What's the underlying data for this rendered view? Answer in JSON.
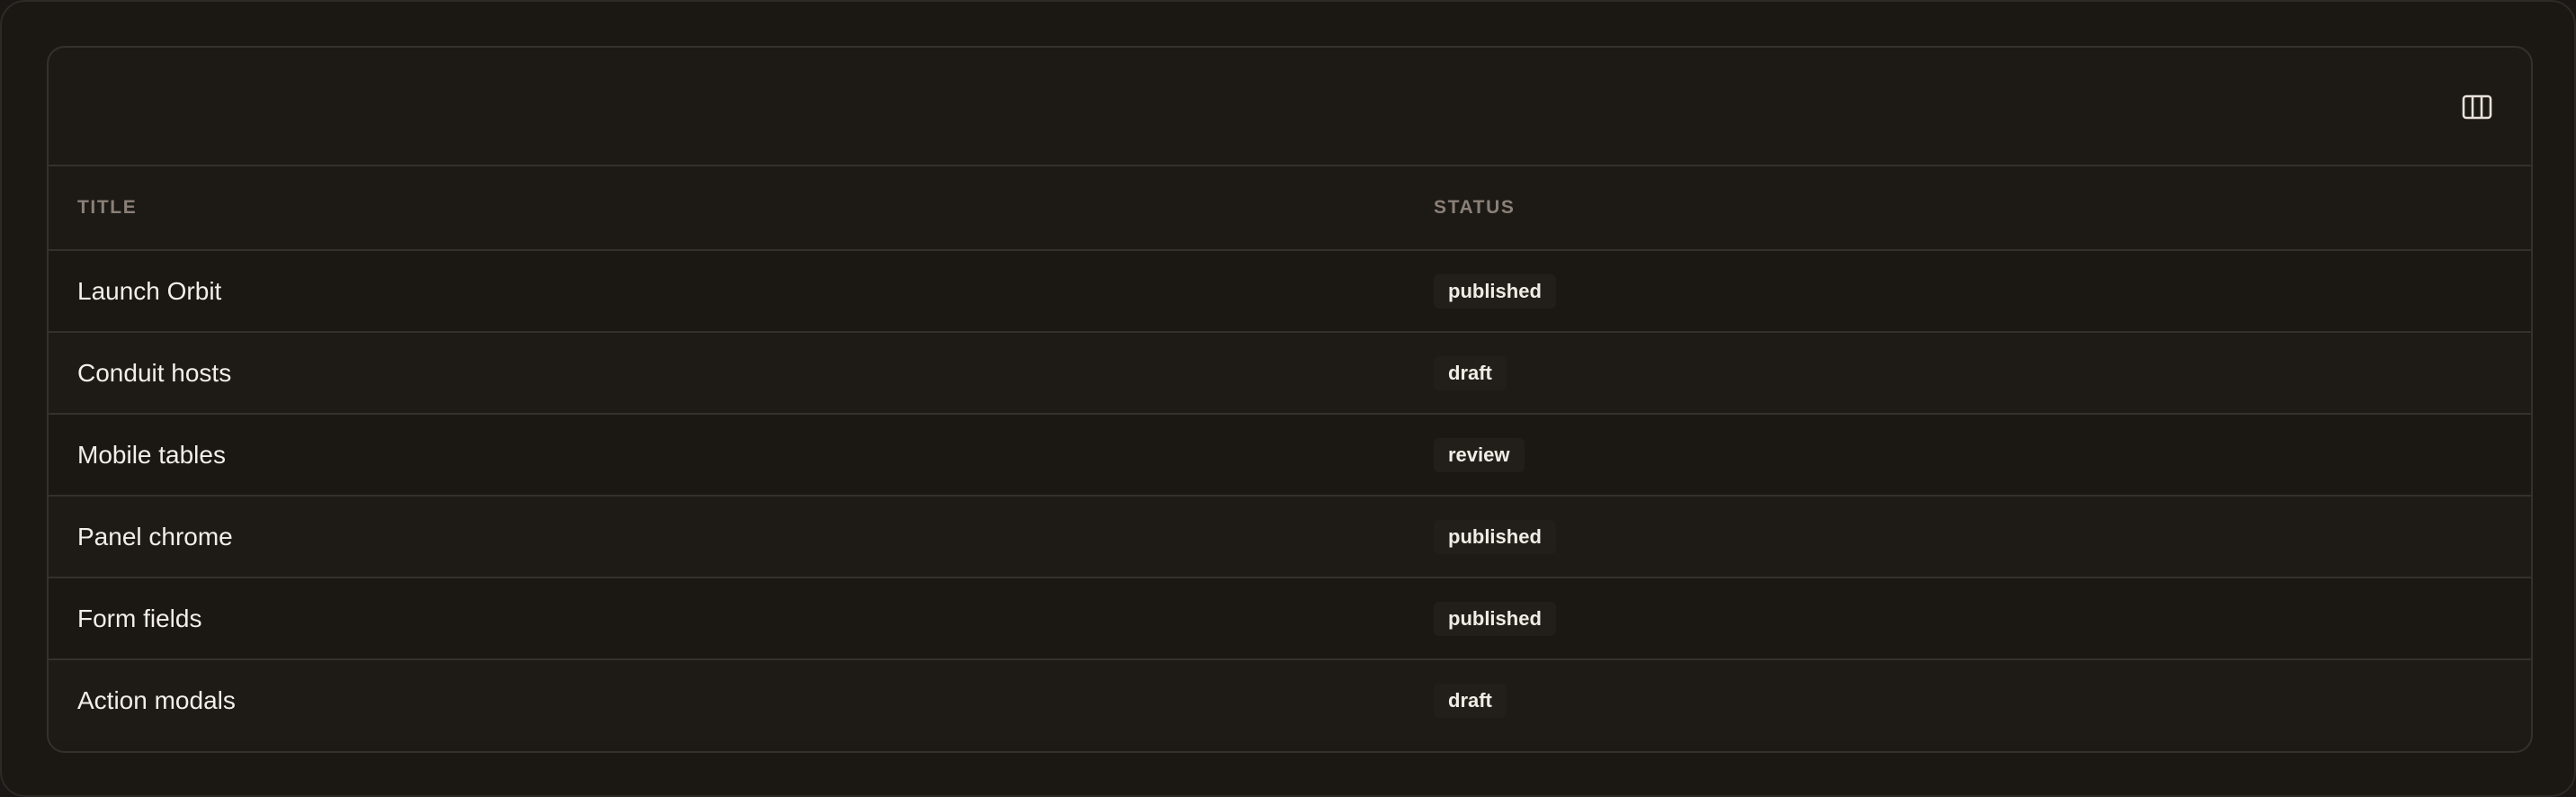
{
  "toolbar": {
    "columns_icon": "columns-icon"
  },
  "table": {
    "headers": {
      "title": "TITLE",
      "status": "STATUS"
    },
    "rows": [
      {
        "title": "Launch Orbit",
        "status": "published"
      },
      {
        "title": "Conduit hosts",
        "status": "draft"
      },
      {
        "title": "Mobile tables",
        "status": "review"
      },
      {
        "title": "Panel chrome",
        "status": "published"
      },
      {
        "title": "Form fields",
        "status": "published"
      },
      {
        "title": "Action modals",
        "status": "draft"
      }
    ]
  },
  "colors": {
    "background": "#1b1814",
    "panel": "#1d1915",
    "border": "#34302b",
    "text": "#f3eee8",
    "header_text": "#8a8078"
  }
}
